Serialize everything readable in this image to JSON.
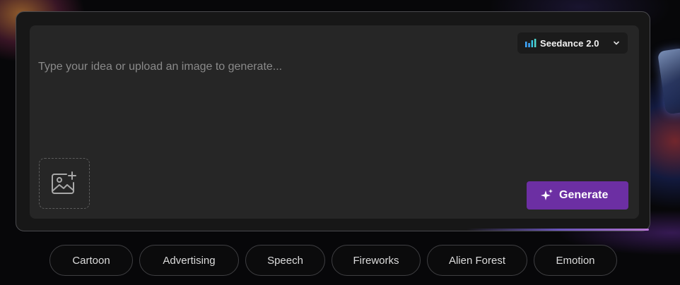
{
  "colors": {
    "accent": "#6c2fa3",
    "card_background": "#171717",
    "input_background": "#262626",
    "text_primary": "#f2f2f2",
    "placeholder": "#8a8a8a"
  },
  "composer": {
    "prompt_placeholder": "Type your idea or upload an image to generate...",
    "prompt_value": "",
    "model_selector": {
      "icon": "bar-chart-icon",
      "selected": "Seedance 2.0",
      "chevron_icon": "chevron-down-icon"
    },
    "upload": {
      "icon": "image-plus-icon"
    },
    "generate_button": {
      "icon": "sparkle-icon",
      "label": "Generate"
    }
  },
  "suggestions": [
    "Cartoon",
    "Advertising",
    "Speech",
    "Fireworks",
    "Alien Forest",
    "Emotion"
  ]
}
